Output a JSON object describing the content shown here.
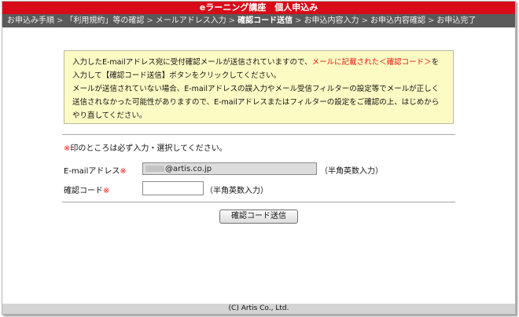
{
  "header": {
    "title": "eラーニング講座　個人申込み"
  },
  "steps": [
    "お申込み手順",
    "「利用規約」等の確認",
    "メールアドレス入力",
    "確認コード送信",
    "お申込内容入力",
    "お申込内容確認",
    "お申込完了"
  ],
  "current_step_index": 3,
  "step_separator": ">",
  "notice": {
    "line1_a": "入力したE-mailアドレス宛に受付確認メールが送信されていますので、",
    "line1_red": "メールに記載された＜確認コード＞",
    "line1_b": "を",
    "line2": "入力して【確認コード送信】ボタンをクリックしてください。",
    "line3": "メールが送信されていない場合、E-mailアドレスの誤入力やメール受信フィルターの設定等でメールが正しく",
    "line4": "送信されなかった可能性がありますので、E-mailアドレスまたはフィルターの設定をご確認の上、はじめから",
    "line5": "やり直してください。"
  },
  "required_note": {
    "mark": "※",
    "text": "印のところは必ず入力・選択してください。"
  },
  "form": {
    "email": {
      "label": "E-mailアドレス",
      "required_mark": "※",
      "value": "@artis.co.jp",
      "hint": "（半角英数入力）"
    },
    "code": {
      "label": "確認コード",
      "required_mark": "※",
      "value": "",
      "hint": "（半角英数入力）"
    },
    "submit_label": "確認コード送信"
  },
  "footer": {
    "copyright": "(C) Artis Co., Ltd."
  },
  "colors": {
    "header_red": "#d80c18",
    "required_red": "#e8150c",
    "notice_bg": "#fdfbc4",
    "steps_bg": "#5a5a5a"
  }
}
